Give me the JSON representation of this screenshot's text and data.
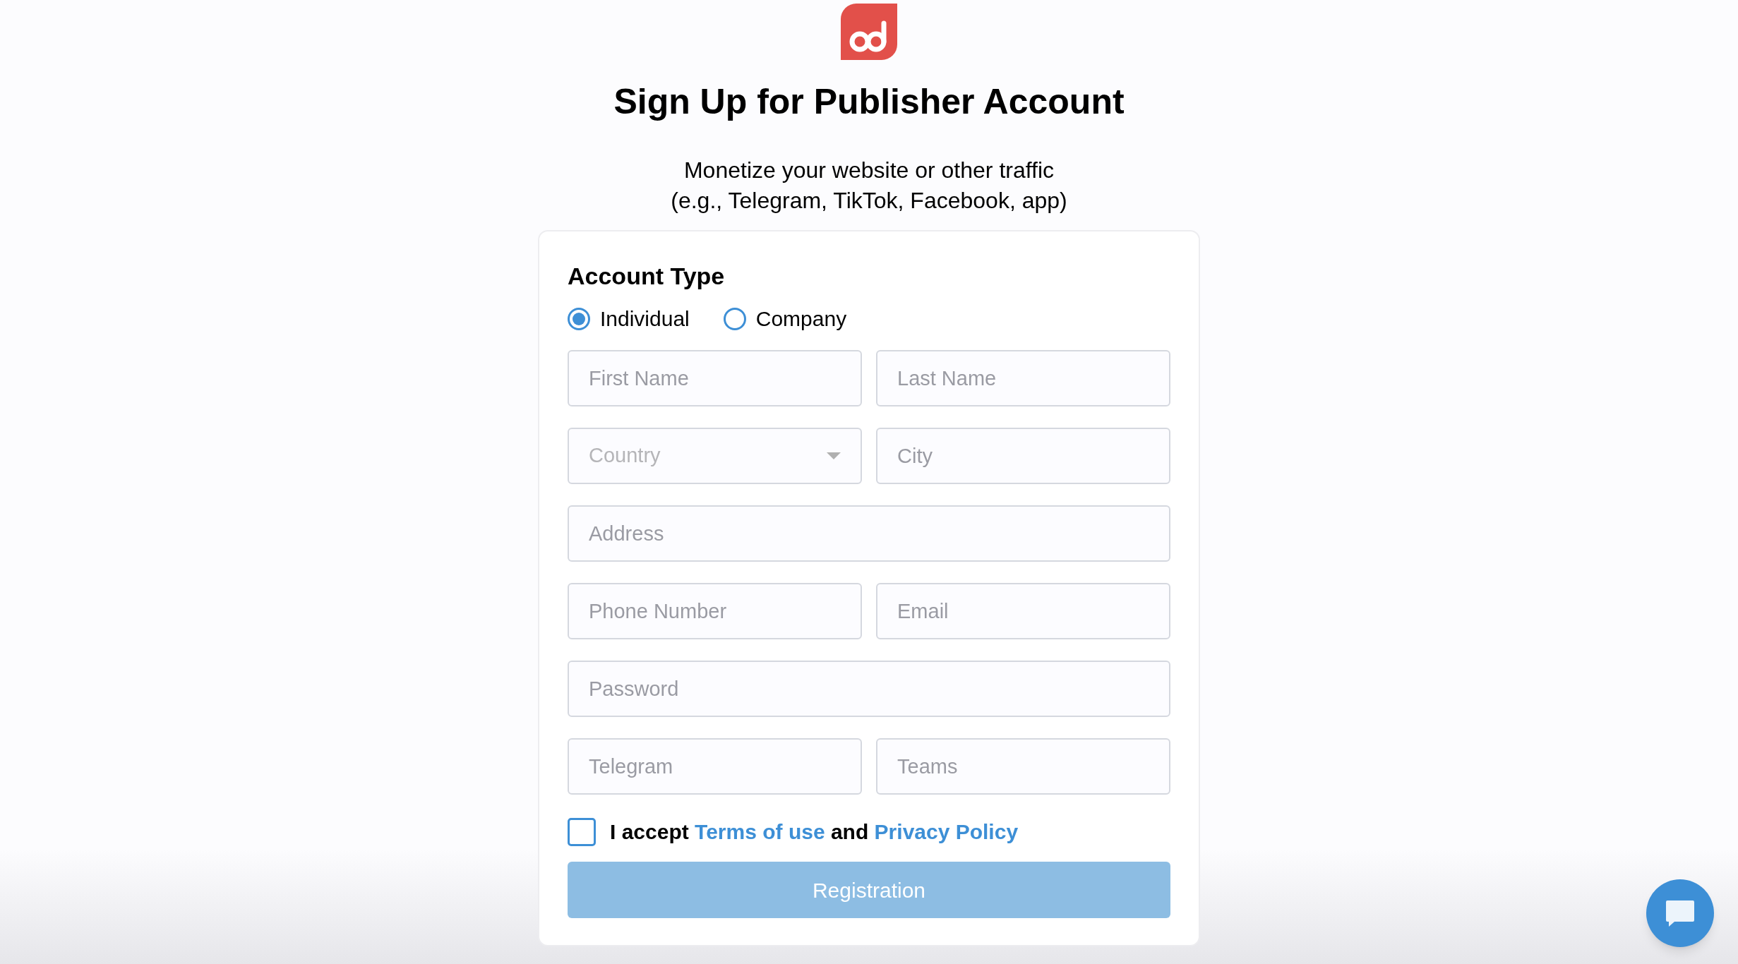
{
  "header": {
    "title": "Sign Up for Publisher Account",
    "subtitle_lines": [
      "Monetize your website or other traffic",
      "(e.g., Telegram, TikTok, Facebook, app)"
    ]
  },
  "form": {
    "section_title": "Account Type",
    "account_types": [
      {
        "label": "Individual",
        "selected": true
      },
      {
        "label": "Company",
        "selected": false
      }
    ],
    "rows": [
      [
        {
          "kind": "text",
          "placeholder": "First Name"
        },
        {
          "kind": "text",
          "placeholder": "Last Name"
        }
      ],
      [
        {
          "kind": "select",
          "placeholder": "Country"
        },
        {
          "kind": "text",
          "placeholder": "City"
        }
      ],
      [
        {
          "kind": "text",
          "placeholder": "Address"
        }
      ],
      [
        {
          "kind": "text",
          "placeholder": "Phone Number"
        },
        {
          "kind": "text",
          "placeholder": "Email"
        }
      ],
      [
        {
          "kind": "password",
          "placeholder": "Password"
        }
      ],
      [
        {
          "kind": "text",
          "placeholder": "Telegram"
        },
        {
          "kind": "text",
          "placeholder": "Teams"
        }
      ]
    ],
    "terms": {
      "checked": false,
      "parts": [
        {
          "kind": "text",
          "text": "I accept"
        },
        {
          "kind": "link",
          "text": "Terms of use"
        },
        {
          "kind": "text",
          "text": "and"
        },
        {
          "kind": "link",
          "text": "Privacy Policy"
        }
      ]
    },
    "submit": {
      "label": "Registration",
      "disabled": true
    }
  }
}
